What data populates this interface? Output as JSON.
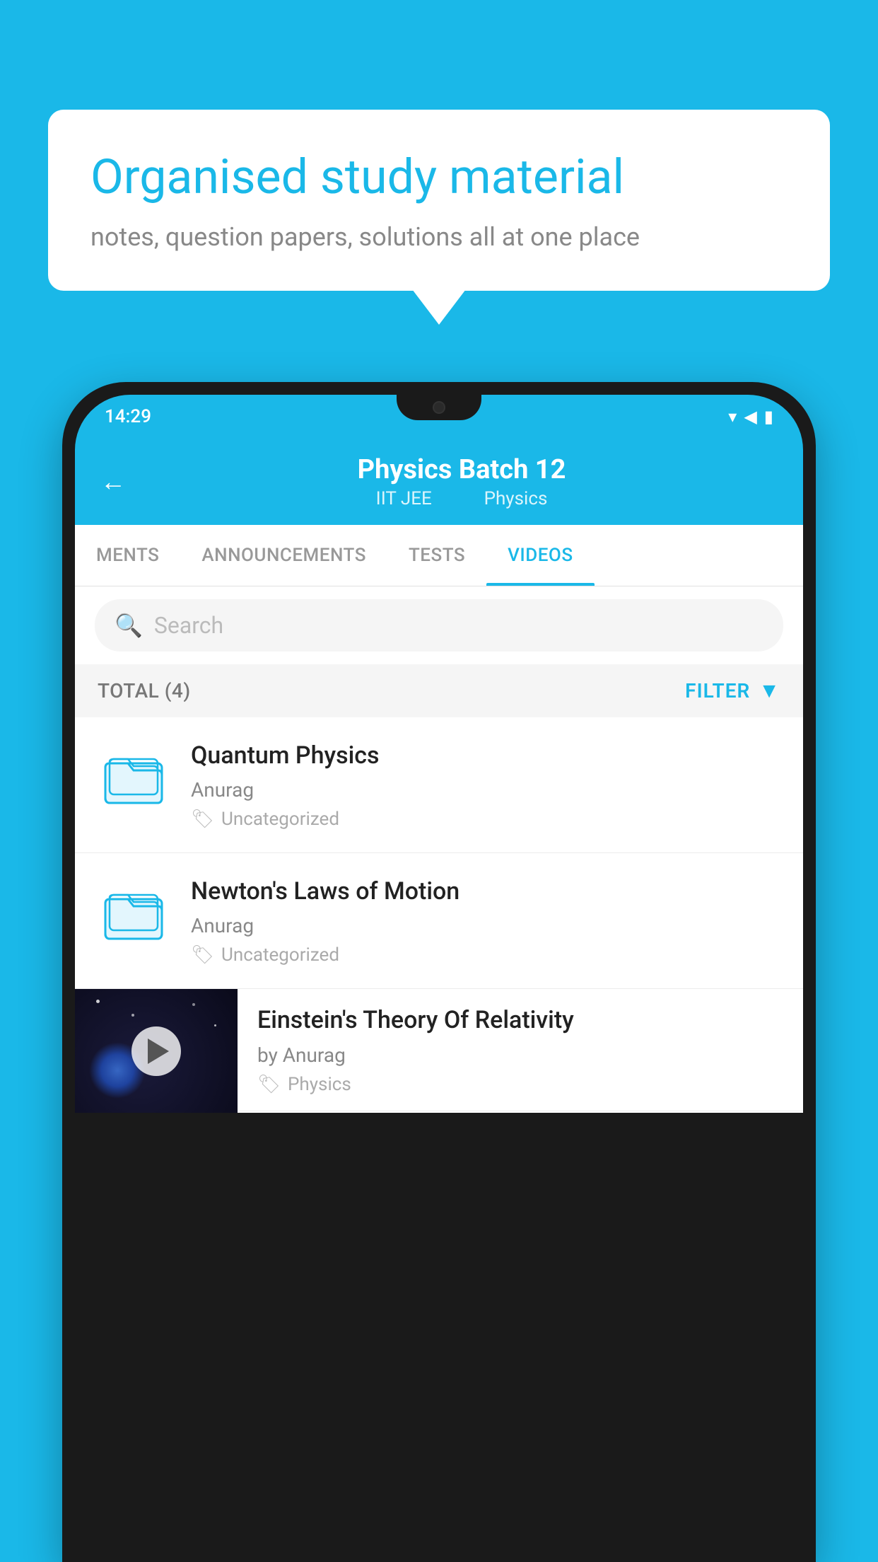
{
  "background": {
    "color": "#1ab8e8"
  },
  "speech_bubble": {
    "title": "Organised study material",
    "subtitle": "notes, question papers, solutions all at one place"
  },
  "phone": {
    "status_bar": {
      "time": "14:29",
      "wifi_icon": "wifi",
      "signal_icon": "signal",
      "battery_icon": "battery"
    },
    "header": {
      "back_label": "←",
      "title": "Physics Batch 12",
      "subtitle_part1": "IIT JEE",
      "subtitle_part2": "Physics"
    },
    "tabs": [
      {
        "label": "MENTS",
        "active": false
      },
      {
        "label": "ANNOUNCEMENTS",
        "active": false
      },
      {
        "label": "TESTS",
        "active": false
      },
      {
        "label": "VIDEOS",
        "active": true
      }
    ],
    "search": {
      "placeholder": "Search"
    },
    "filter_row": {
      "total_label": "TOTAL (4)",
      "filter_label": "FILTER"
    },
    "video_items": [
      {
        "id": 1,
        "title": "Quantum Physics",
        "author": "Anurag",
        "tag": "Uncategorized",
        "has_thumbnail": false
      },
      {
        "id": 2,
        "title": "Newton's Laws of Motion",
        "author": "Anurag",
        "tag": "Uncategorized",
        "has_thumbnail": false
      },
      {
        "id": 3,
        "title": "Einstein's Theory Of Relativity",
        "author": "by Anurag",
        "tag": "Physics",
        "has_thumbnail": true
      }
    ]
  }
}
